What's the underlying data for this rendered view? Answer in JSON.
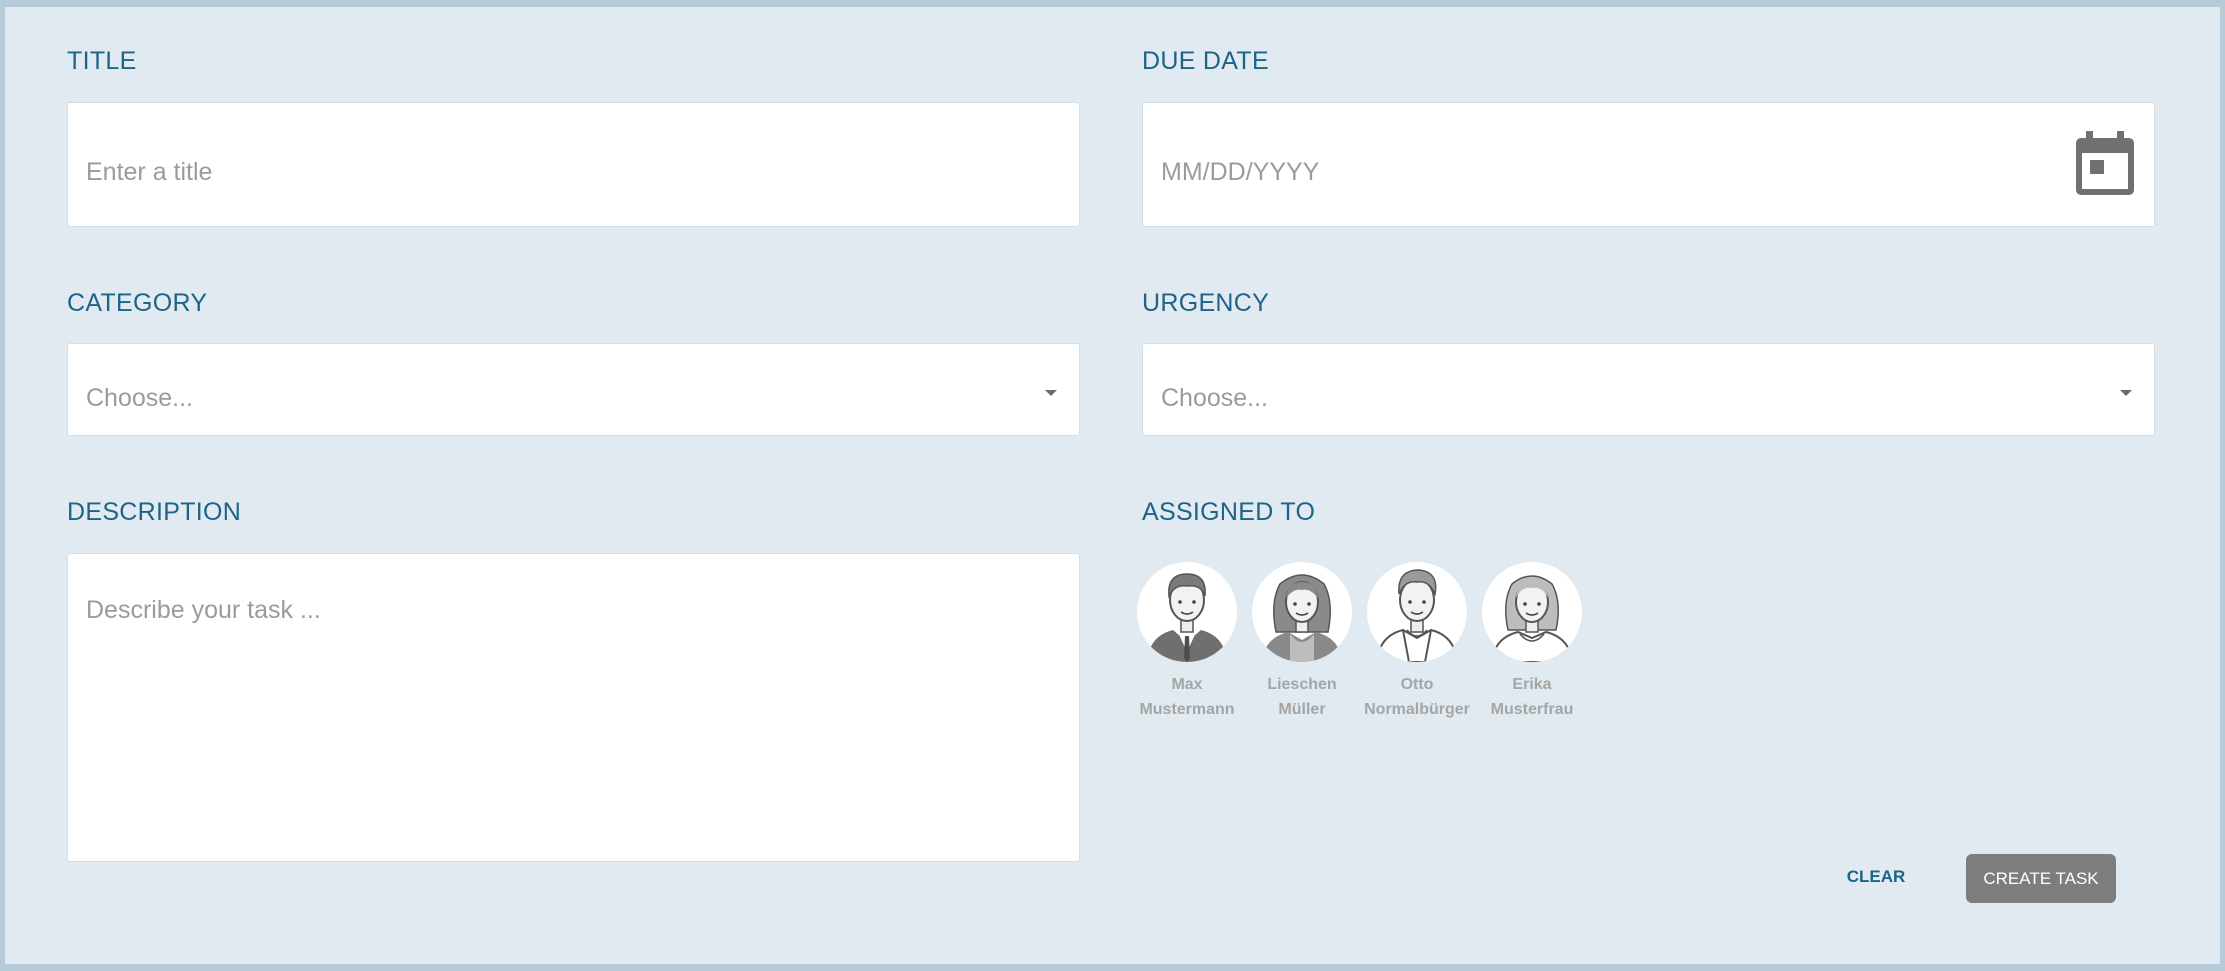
{
  "form": {
    "title": {
      "label": "TITLE",
      "placeholder": "Enter a title"
    },
    "due_date": {
      "label": "DUE DATE",
      "placeholder": "MM/DD/YYYY"
    },
    "category": {
      "label": "CATEGORY",
      "placeholder": "Choose..."
    },
    "urgency": {
      "label": "URGENCY",
      "placeholder": "Choose..."
    },
    "description": {
      "label": "DESCRIPTION",
      "placeholder": "Describe your task ..."
    },
    "assigned_to": {
      "label": "ASSIGNED TO",
      "people": [
        {
          "first": "Max",
          "last": "Mustermann",
          "icon": "male-suit-avatar-icon"
        },
        {
          "first": "Lieschen",
          "last": "Müller",
          "icon": "female-long-hair-avatar-icon"
        },
        {
          "first": "Otto",
          "last": "Normalbürger",
          "icon": "male-casual-avatar-icon"
        },
        {
          "first": "Erika",
          "last": "Musterfrau",
          "icon": "female-avatar-icon"
        }
      ]
    }
  },
  "actions": {
    "clear_label": "CLEAR",
    "create_label": "CREATE TASK"
  },
  "colors": {
    "label": "#1d6486",
    "panel": "#e1eaf0",
    "button": "#7d7d7d"
  }
}
